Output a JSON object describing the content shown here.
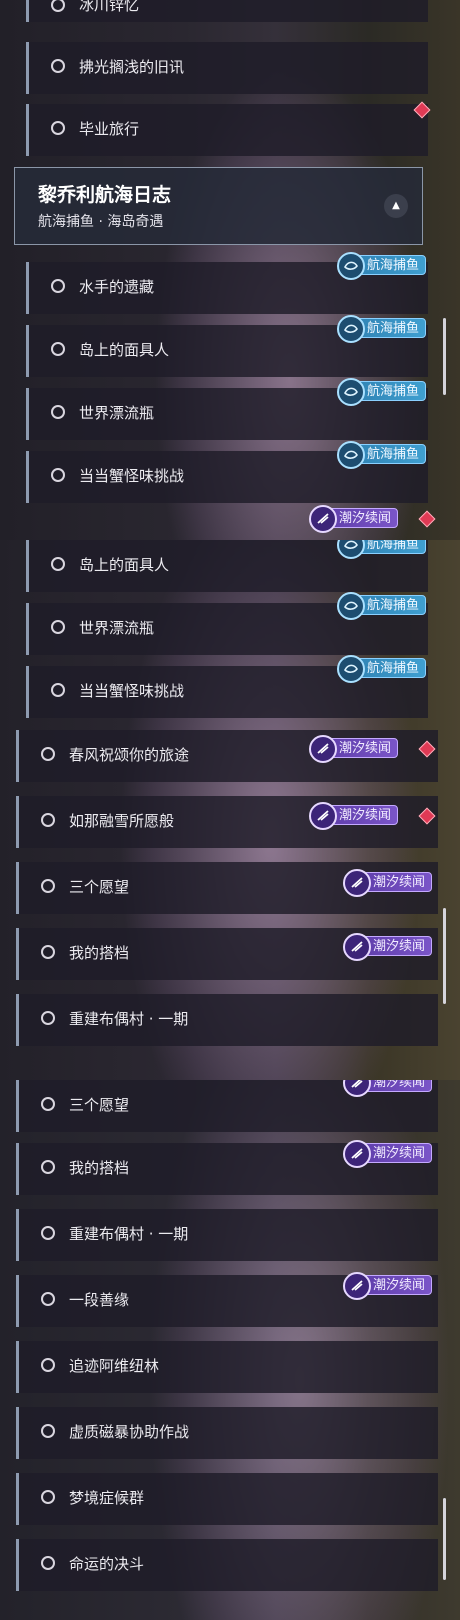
{
  "panel1": {
    "top_partial": "冰川锌忆",
    "rows_a": [
      "拂光搁浅的旧讯",
      "毕业旅行"
    ],
    "header": {
      "title": "黎乔利航海日志",
      "subtitle": "航海捕鱼 · 海岛奇遇"
    },
    "rows_b": [
      "水手的遗藏",
      "岛上的面具人",
      "世界漂流瓶",
      "当当蟹怪味挑战"
    ],
    "partial_badge": "潮汐续闻"
  },
  "panel2": {
    "rows_fish": [
      "岛上的面具人",
      "世界漂流瓶",
      "当当蟹怪味挑战"
    ],
    "rows_tide": [
      "春风祝颂你的旅途",
      "如那融雪所愿般",
      "三个愿望",
      "我的搭档",
      "重建布偶村 · 一期"
    ]
  },
  "panel3": {
    "rows": [
      "三个愿望",
      "我的搭档",
      "重建布偶村 · 一期",
      "一段善缘",
      "追迹阿维纽林",
      "虚质磁暴协助作战",
      "梦境症候群",
      "命运的决斗"
    ]
  },
  "badges": {
    "fishing": "航海捕鱼",
    "tide": "潮汐续闻"
  },
  "colors": {
    "fishing_badge": "#3f9fd0",
    "tide_badge": "#7a55c8",
    "new_marker": "#e03a55"
  }
}
